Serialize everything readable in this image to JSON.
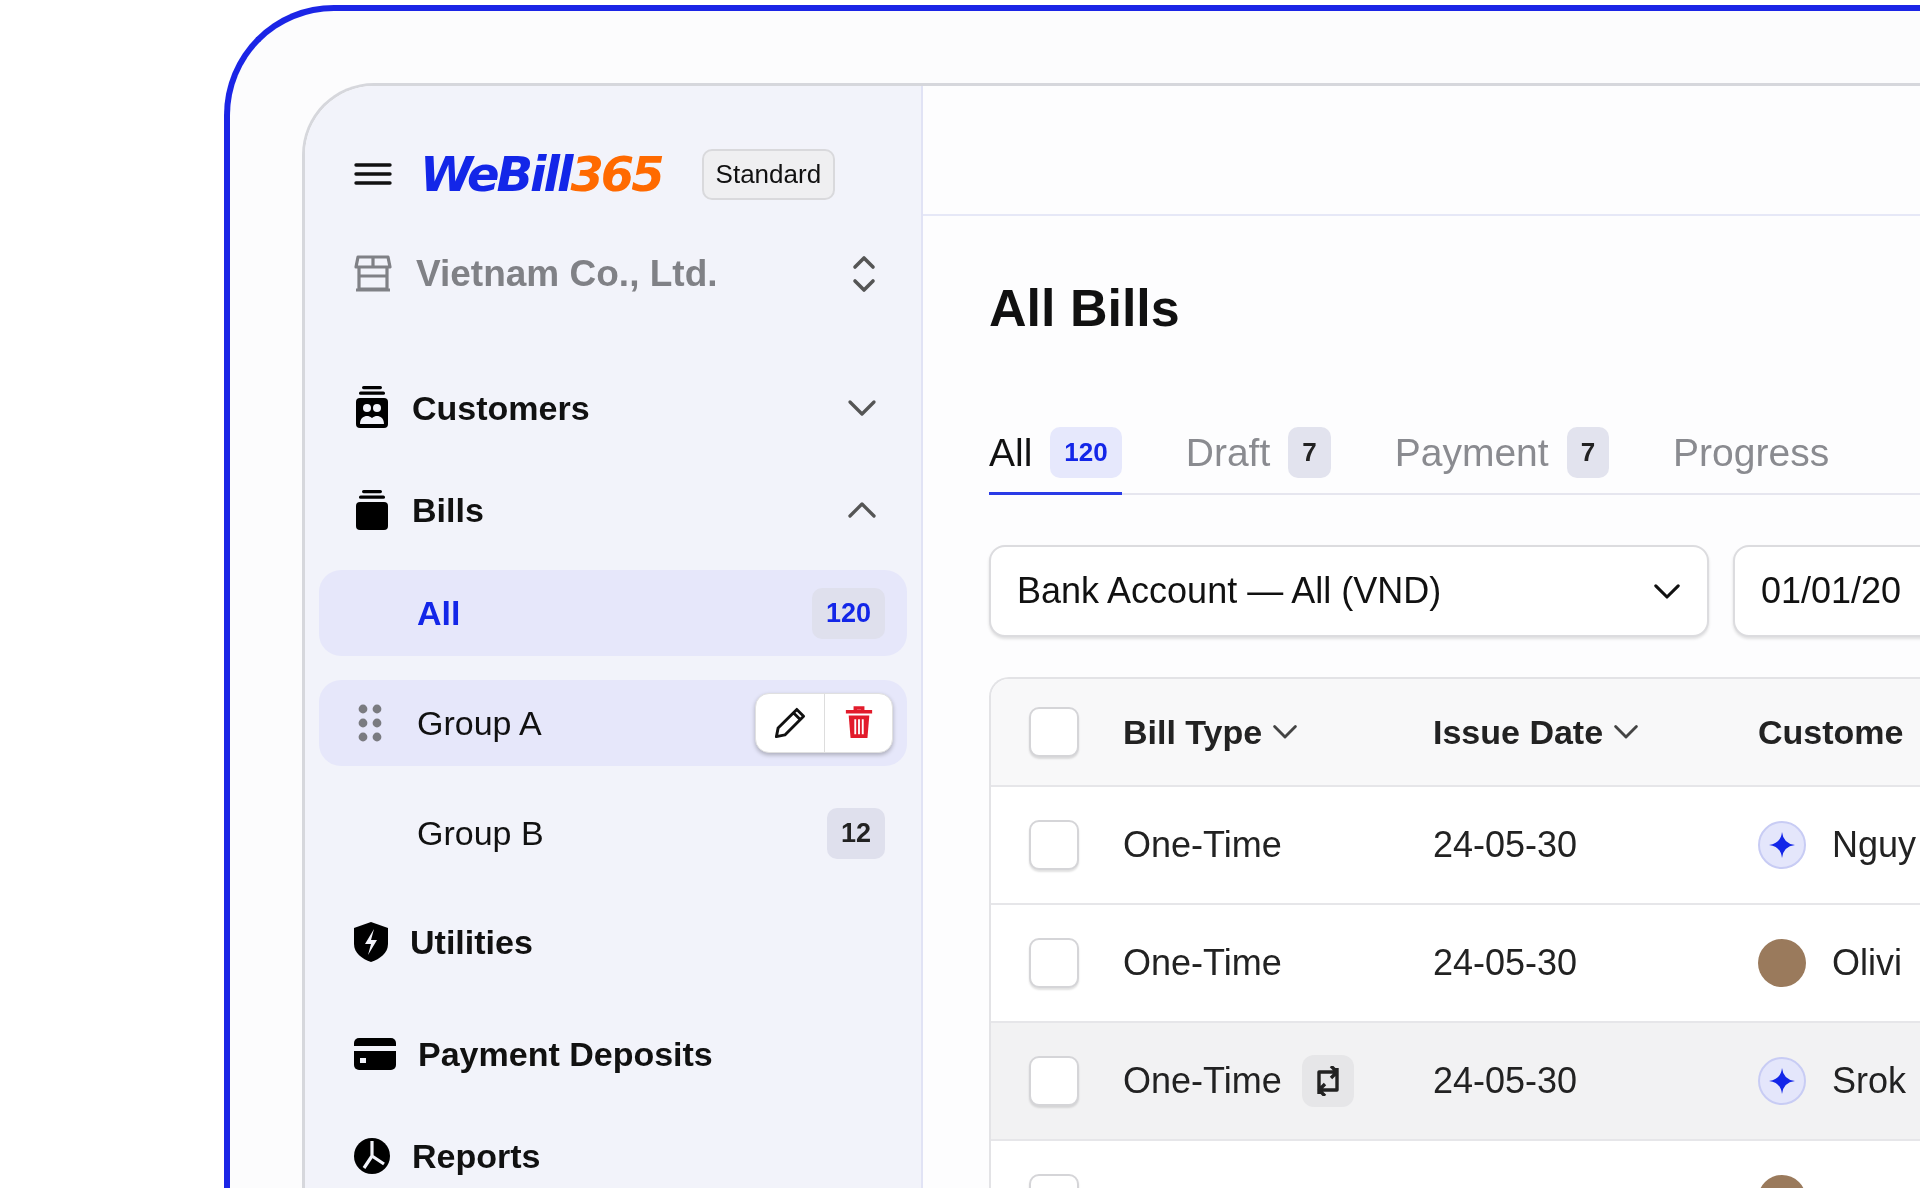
{
  "sidebar": {
    "logo": {
      "part1": "WeBill",
      "part2": "365"
    },
    "plan_badge": "Standard",
    "company": "Vietnam Co., Ltd.",
    "nav": [
      {
        "label": "Customers",
        "expanded": false
      },
      {
        "label": "Bills",
        "expanded": true,
        "children": [
          {
            "label": "All",
            "count": "120",
            "selected": true,
            "hovered": false
          },
          {
            "label": "Group A",
            "selected": false,
            "hovered": true
          },
          {
            "label": "Group B",
            "count": "12",
            "selected": false,
            "hovered": false
          }
        ]
      },
      {
        "label": "Utilities"
      },
      {
        "label": "Payment Deposits"
      },
      {
        "label": "Reports"
      }
    ]
  },
  "main": {
    "title": "All Bills",
    "tabs": [
      {
        "label": "All",
        "count": "120",
        "selected": true
      },
      {
        "label": "Draft",
        "count": "7",
        "selected": false
      },
      {
        "label": "Payment",
        "count": "7",
        "selected": false
      },
      {
        "label": "Progress",
        "selected": false
      }
    ],
    "filters": {
      "bank_account": "Bank Account — All (VND)",
      "date_from": "01/01/20"
    },
    "table": {
      "select_all_checked": false,
      "columns": [
        "Bill Type",
        "Issue Date",
        "Custome"
      ],
      "rows": [
        {
          "bill_type": "One-Time",
          "recurring": false,
          "issue_date": "24-05-30",
          "avatar": {
            "kind": "sparkle"
          },
          "customer": "Nguy",
          "checked": false,
          "hovered": false
        },
        {
          "bill_type": "One-Time",
          "recurring": false,
          "issue_date": "24-05-30",
          "avatar": {
            "kind": "photo"
          },
          "customer": "Olivi",
          "checked": false,
          "hovered": false
        },
        {
          "bill_type": "One-Time",
          "recurring": true,
          "issue_date": "24-05-30",
          "avatar": {
            "kind": "sparkle"
          },
          "customer": "Srok",
          "checked": false,
          "hovered": true
        },
        {
          "recurring": false,
          "avatar": {
            "kind": "photo"
          },
          "checked": false,
          "hovered": false
        }
      ]
    }
  }
}
